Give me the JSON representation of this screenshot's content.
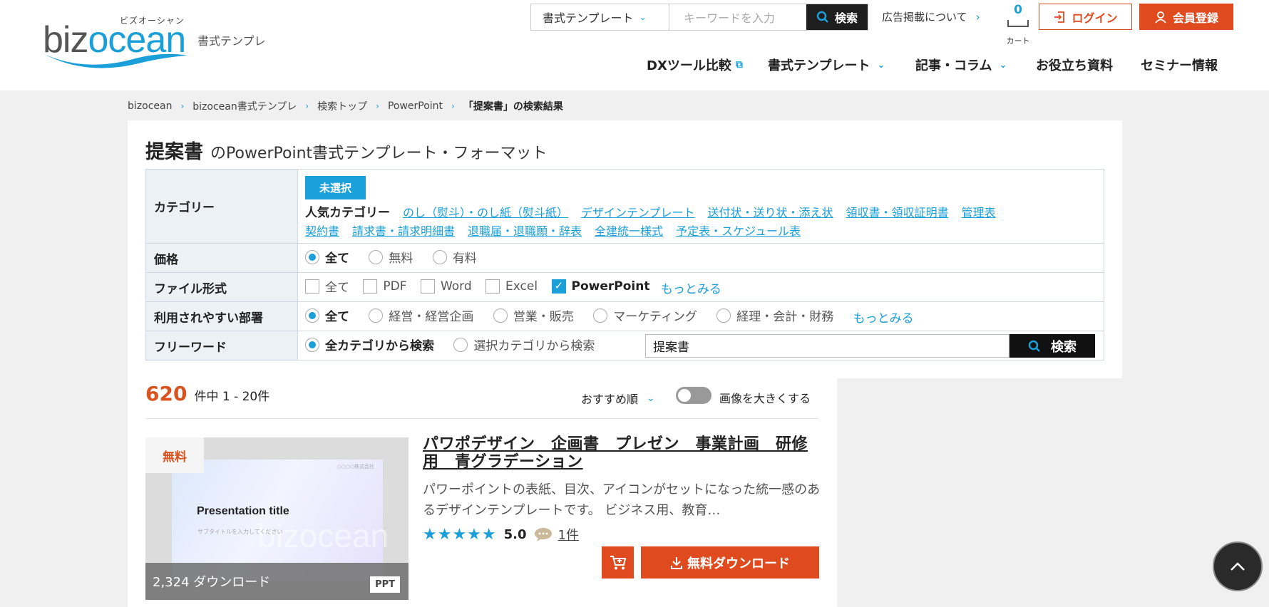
{
  "header": {
    "logo_kana": "ビズオーシャン",
    "logo_b": "biz",
    "logo_o": "ocean",
    "logo_sub": "書式テンプレ",
    "search_category": "書式テンプレート",
    "search_placeholder": "キーワードを入力",
    "search_button": "検索",
    "ad_link": "広告掲載について",
    "cart_count": "0",
    "cart_label": "カート",
    "login": "ログイン",
    "register": "会員登録",
    "nav": [
      "DXツール比較",
      "書式テンプレート",
      "記事・コラム",
      "お役立ち資料",
      "セミナー情報"
    ]
  },
  "breadcrumb": [
    "bizocean",
    "bizocean書式テンプレ",
    "検索トップ",
    "PowerPoint",
    "「提案書」の検索結果"
  ],
  "title": {
    "keyword": "提案書",
    "rest": "のPowerPoint書式テンプレート・フォーマット"
  },
  "filters": {
    "category_label": "カテゴリー",
    "unselected": "未選択",
    "popular_label": "人気カテゴリー",
    "popular": [
      "のし（熨斗）・のし紙（熨斗紙）",
      "デザインテンプレート",
      "送付状・送り状・添え状",
      "領収書・領収証明書",
      "管理表",
      "契約書",
      "請求書・請求明細書",
      "退職届・退職願・辞表",
      "全建統一様式",
      "予定表・スケジュール表"
    ],
    "price_label": "価格",
    "price_options": [
      "全て",
      "無料",
      "有料"
    ],
    "format_label": "ファイル形式",
    "format_options": [
      "全て",
      "PDF",
      "Word",
      "Excel",
      "PowerPoint"
    ],
    "format_more": "もっとみる",
    "dept_label": "利用されやすい部署",
    "dept_options": [
      "全て",
      "経営・経営企画",
      "営業・販売",
      "マーケティング",
      "経理・会計・財務"
    ],
    "dept_more": "もっとみる",
    "freeword_label": "フリーワード",
    "freeword_options": [
      "全カテゴリから検索",
      "選択カテゴリから検索"
    ],
    "freeword_value": "提案書",
    "freeword_button": "検索"
  },
  "results": {
    "count": "620",
    "count_text": "件中 1 - 20件",
    "sort": "おすすめ順",
    "toggle_label": "画像を大きくする"
  },
  "item": {
    "free_tag": "無料",
    "slide_title": "Presentation title",
    "slide_company": "○○○○株式会社",
    "slide_sub": "サブタイトルを入力してください",
    "slide_watermark": "bizocean",
    "downloads": "2,324 ダウンロード",
    "file_type": "PPT",
    "title": "パワポデザイン　企画書　プレゼン　事業計画　研修用　青グラデーション",
    "description": "パワーポイントの表紙、目次、アイコンがセットになった統一感のあるデザインテンプレートです。 ビジネス用、教育…",
    "stars": "★★★★★",
    "score": "5.0",
    "reviews": "1件",
    "download_button": "無料ダウンロード"
  },
  "colors": {
    "accent_blue": "#1a9fd9",
    "accent_orange": "#e04a1f"
  }
}
